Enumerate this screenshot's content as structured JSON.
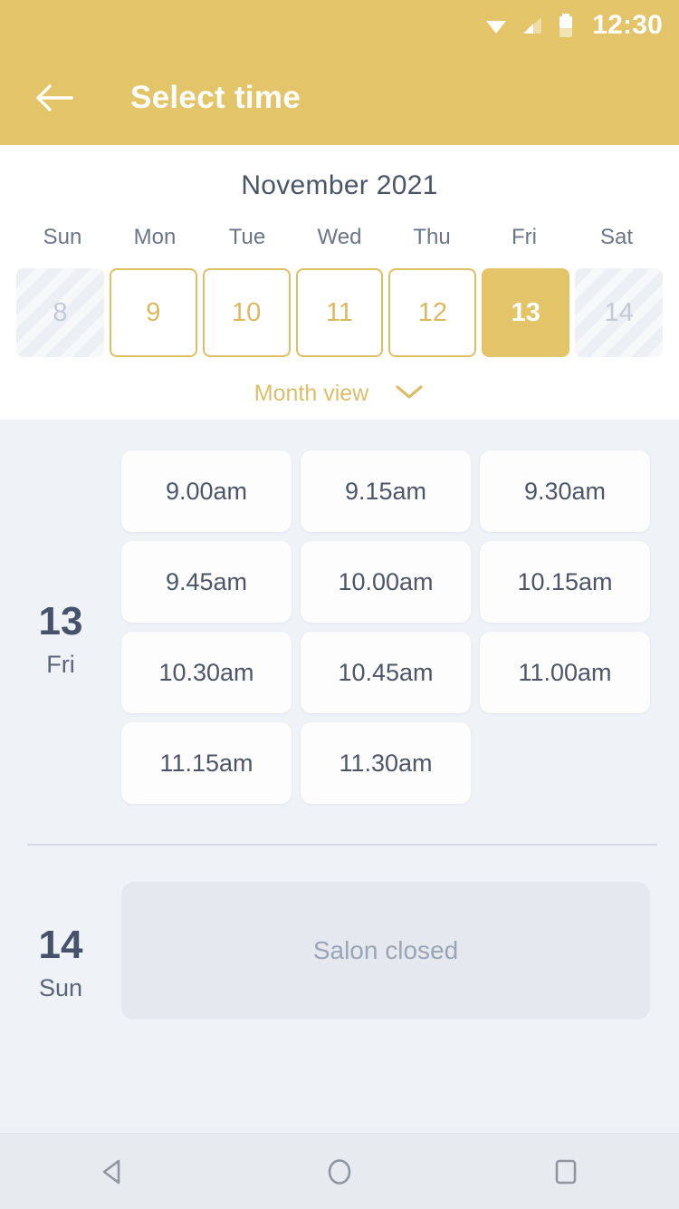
{
  "status_bar": {
    "time": "12:30",
    "icons": [
      "wifi-icon",
      "signal-icon",
      "battery-icon"
    ]
  },
  "app_bar": {
    "back_icon": "back-arrow-icon",
    "title": "Select time",
    "background_color": "#e3c468",
    "text_color": "#ffffff"
  },
  "calendar": {
    "month_title": "November 2021",
    "weekdays": [
      "Sun",
      "Mon",
      "Tue",
      "Wed",
      "Thu",
      "Fri",
      "Sat"
    ],
    "dates": [
      {
        "day": "8",
        "state": "disabled"
      },
      {
        "day": "9",
        "state": "available"
      },
      {
        "day": "10",
        "state": "available"
      },
      {
        "day": "11",
        "state": "available"
      },
      {
        "day": "12",
        "state": "available"
      },
      {
        "day": "13",
        "state": "selected"
      },
      {
        "day": "14",
        "state": "disabled"
      }
    ],
    "view_toggle": {
      "label": "Month view",
      "icon": "chevron-down-icon",
      "color": "#dcbe6a"
    }
  },
  "schedule": {
    "days": [
      {
        "day_number": "13",
        "day_name": "Fri",
        "slots": [
          "9.00am",
          "9.15am",
          "9.30am",
          "9.45am",
          "10.00am",
          "10.15am",
          "10.30am",
          "10.45am",
          "11.00am",
          "11.15am",
          "11.30am"
        ]
      },
      {
        "day_number": "14",
        "day_name": "Sun",
        "closed_message": "Salon closed"
      }
    ]
  },
  "nav_bar": {
    "buttons": [
      "back-triangle-icon",
      "home-circle-icon",
      "recents-square-icon"
    ]
  }
}
